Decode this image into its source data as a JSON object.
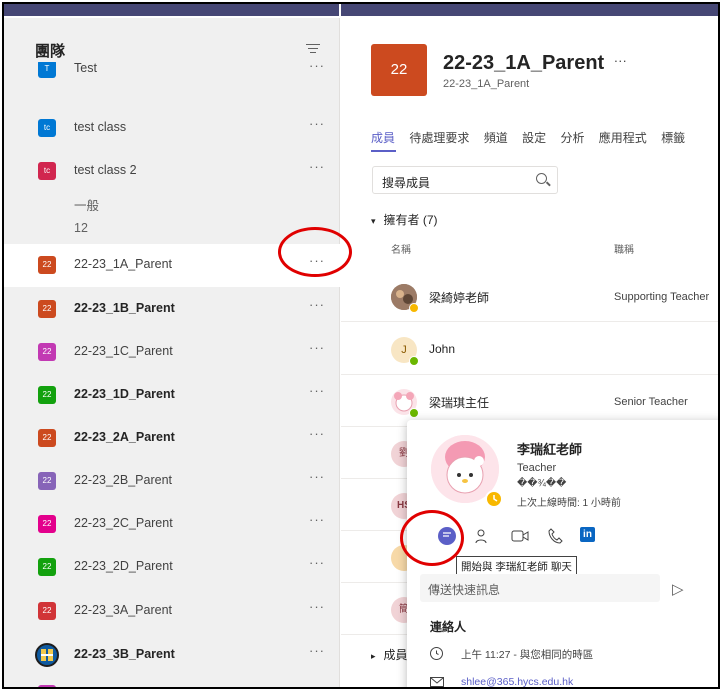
{
  "sidebar": {
    "title": "團隊",
    "teams": [
      {
        "label": "Test",
        "tile": "T",
        "color": "#0078d4"
      },
      {
        "label": "test class",
        "tile": "tc",
        "color": "#0078d4"
      },
      {
        "label": "test class 2",
        "tile": "tc",
        "color": "#d1264f"
      },
      {
        "label": "22-23_1A_Parent",
        "tile": "22",
        "color": "#cc4a1f"
      },
      {
        "label": "22-23_1B_Parent",
        "tile": "22",
        "color": "#cc4a1f"
      },
      {
        "label": "22-23_1C_Parent",
        "tile": "22",
        "color": "#c239b3"
      },
      {
        "label": "22-23_1D_Parent",
        "tile": "22",
        "color": "#13a10e"
      },
      {
        "label": "22-23_2A_Parent",
        "tile": "22",
        "color": "#cc4a1f"
      },
      {
        "label": "22-23_2B_Parent",
        "tile": "22",
        "color": "#8764b8"
      },
      {
        "label": "22-23_2C_Parent",
        "tile": "22",
        "color": "#e3008c"
      },
      {
        "label": "22-23_2D_Parent",
        "tile": "22",
        "color": "#13a10e"
      },
      {
        "label": "22-23_3A_Parent",
        "tile": "22",
        "color": "#d13438"
      },
      {
        "label": "22-23_3B_Parent",
        "tile": "",
        "color": "#0f5aa0"
      }
    ],
    "channels": [
      "一般",
      "12"
    ],
    "more": "···"
  },
  "main": {
    "team_tile": "22",
    "team_title": "22-23_1A_Parent",
    "team_more": "···",
    "team_sub": "22-23_1A_Parent",
    "tabs": [
      "成員",
      "待處理要求",
      "頻道",
      "設定",
      "分析",
      "應用程式",
      "標籤"
    ],
    "search_placeholder": "搜尋成員",
    "owners_label": "擁有者 (7)",
    "owners_caret": "▾",
    "col_name": "名稱",
    "col_role": "職稱",
    "members": [
      {
        "name": "梁綺婷老師",
        "role": "Supporting Teacher",
        "avatar_color": "#8a6d5a",
        "initial": "",
        "status": "away"
      },
      {
        "name": "John",
        "role": "",
        "avatar_color": "#f8e6c4",
        "initial": "J",
        "status": "available"
      },
      {
        "name": "梁瑞琪主任",
        "role": "Senior Teacher",
        "avatar_color": "#fbe3e8",
        "initial": "",
        "status": "available"
      },
      {
        "name": "",
        "role": "",
        "avatar_color": "#f1d3d6",
        "initial": "劉",
        "status": ""
      },
      {
        "name": "",
        "role": "",
        "avatar_color": "#f1d3d6",
        "initial": "HS",
        "status": ""
      },
      {
        "name": "",
        "role": "",
        "avatar_color": "#f7d9a8",
        "initial": "",
        "status": ""
      },
      {
        "name": "",
        "role": "",
        "avatar_color": "#f1d3d6",
        "initial": "簡",
        "status": ""
      }
    ],
    "members_section": "成員",
    "members_caret": "▸"
  },
  "card": {
    "name": "李瑞紅老師",
    "title": "Teacher",
    "garbled": "��¾��",
    "last_seen": "上次上線時間: 1 小時前",
    "tooltip": "開始與 李瑞紅老師 聊天",
    "quick_placeholder": "傳送快速訊息",
    "send_icon": "▷",
    "contact_header": "連絡人",
    "local_time": "上午 11:27 - 與您相同的時區",
    "email": "shlee@365.hycs.edu.hk",
    "linkedin": "in"
  },
  "colors": {
    "accent": "#5b5fc7",
    "annotation_red": "#e00000",
    "teams_purple": "#464775"
  }
}
